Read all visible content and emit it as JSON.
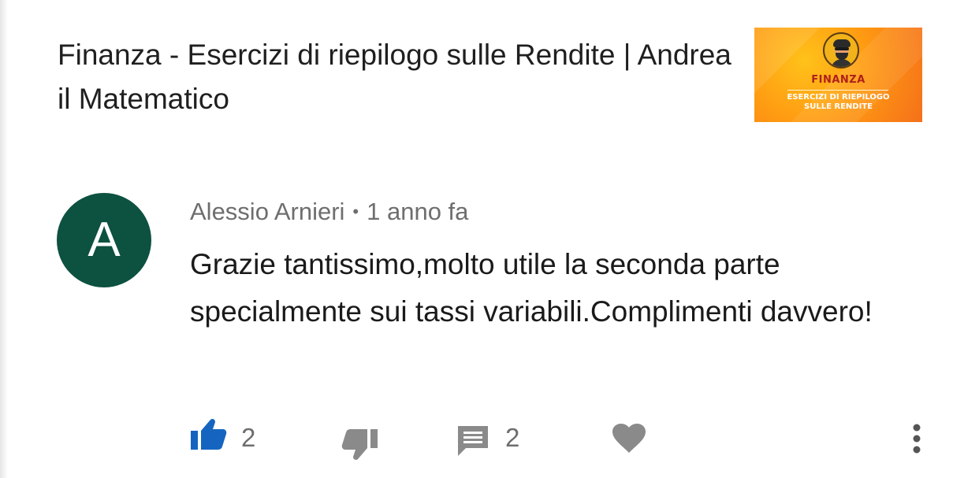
{
  "video": {
    "title": "Finanza - Esercizi di riepilogo sulle Rendite | Andrea il Matematico",
    "thumbnail": {
      "heading": "FINANZA",
      "subtitle_line1": "ESERCIZI DI RIEPILOGO",
      "subtitle_line2": "SULLE RENDITE"
    }
  },
  "comment": {
    "avatar_letter": "A",
    "author": "Alessio Arnieri",
    "separator": "•",
    "time": "1 anno fa",
    "text": "Grazie tantissimo,molto utile la seconda parte specialmente sui tassi variabili.Complimenti davvero!",
    "avatar_color": "#0d5140"
  },
  "actions": {
    "like_count": "2",
    "reply_count": "2",
    "like_icon": "thumbs-up-icon",
    "dislike_icon": "thumbs-down-icon",
    "reply_icon": "comment-icon",
    "heart_icon": "heart-icon",
    "more_icon": "more-vertical-icon",
    "like_color": "#1565c0",
    "icon_color": "#8a8a8a"
  }
}
